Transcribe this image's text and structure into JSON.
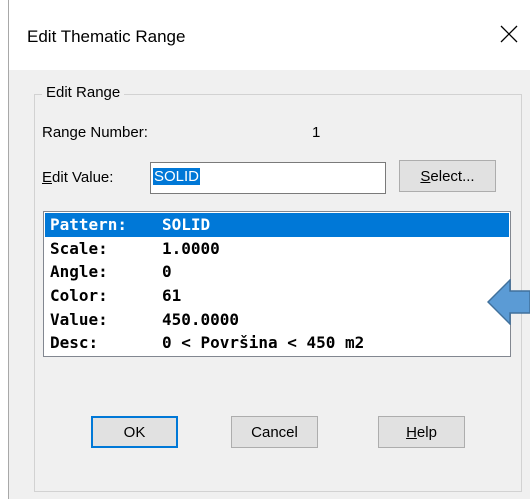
{
  "dialog": {
    "title": "Edit Thematic Range",
    "close_glyph": "✕"
  },
  "group": {
    "legend": "Edit Range"
  },
  "range_number": {
    "label": "Range Number:",
    "value": "1"
  },
  "edit_value": {
    "label_mnemonic": "E",
    "label_rest": "dit Value:",
    "input_value": "SOLID"
  },
  "buttons": {
    "select": {
      "mnemonic": "S",
      "rest": "elect..."
    },
    "ok": {
      "label": "OK"
    },
    "cancel": {
      "label": "Cancel"
    },
    "help": {
      "mnemonic": "H",
      "rest": "elp"
    }
  },
  "pattern_list": {
    "rows": [
      {
        "key": "Pattern:",
        "value": "SOLID",
        "selected": true
      },
      {
        "key": "Scale:",
        "value": "1.0000",
        "selected": false
      },
      {
        "key": "Angle:",
        "value": "0",
        "selected": false
      },
      {
        "key": "Color:",
        "value": "61",
        "selected": false
      },
      {
        "key": "Value:",
        "value": "450.0000",
        "selected": false
      },
      {
        "key": "Desc:",
        "value": "0 < Površina < 450 m2",
        "selected": false
      }
    ]
  },
  "annotation": {
    "arrow_icon": "left-arrow-icon",
    "arrow_color": "#5b9bd5",
    "arrow_stroke": "#41719c"
  },
  "colors": {
    "accent": "#0078d7"
  }
}
